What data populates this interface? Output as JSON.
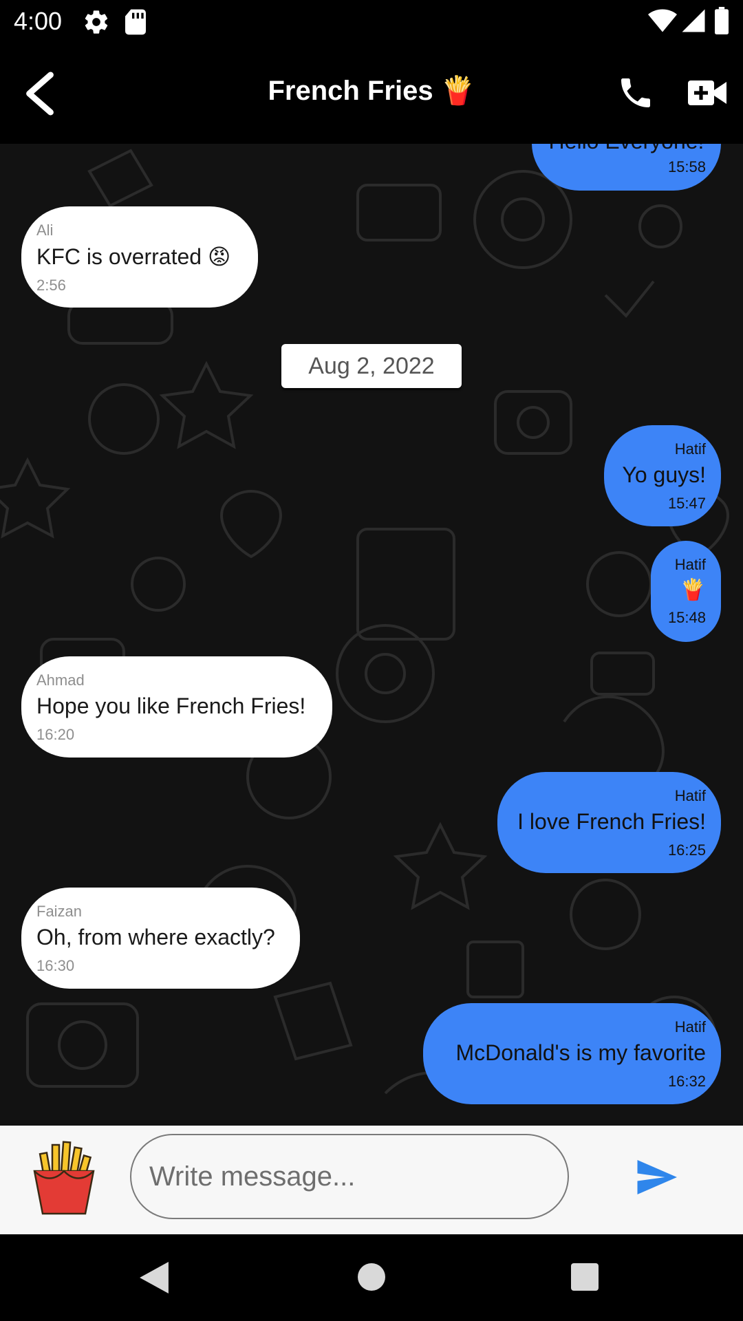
{
  "status_bar": {
    "time": "4:00",
    "icons": [
      "gear-icon",
      "sd-card-icon",
      "wifi-icon",
      "signal-icon",
      "battery-icon"
    ]
  },
  "header": {
    "title": "French Fries 🍟",
    "icons": [
      "back-arrow-icon",
      "phone-icon",
      "video-camera-icon"
    ]
  },
  "chat": {
    "partial_top_message": {
      "text": "Hello Everyone!",
      "time": "15:58"
    },
    "date_separator": "Aug 2, 2022",
    "messages": [
      {
        "sender": "Ali",
        "text": "KFC is overrated 😡",
        "time": "2:56",
        "direction": "incoming"
      },
      {
        "sender": "Hatif",
        "text": "Yo guys!",
        "time": "15:47",
        "direction": "outgoing"
      },
      {
        "sender": "Hatif",
        "text": "🍟",
        "time": "15:48",
        "direction": "outgoing"
      },
      {
        "sender": "Ahmad",
        "text": "Hope you like French Fries!",
        "time": "16:20",
        "direction": "incoming"
      },
      {
        "sender": "Hatif",
        "text": "I love French Fries!",
        "time": "16:25",
        "direction": "outgoing"
      },
      {
        "sender": "Faizan",
        "text": "Oh, from where exactly?",
        "time": "16:30",
        "direction": "incoming"
      },
      {
        "sender": "Hatif",
        "text": "McDonald's is my favorite",
        "time": "16:32",
        "direction": "outgoing"
      }
    ]
  },
  "composer": {
    "placeholder": "Write message...",
    "value": "",
    "icons": [
      "french-fries-icon",
      "send-icon"
    ]
  },
  "nav_bar": {
    "icons": [
      "nav-back-icon",
      "nav-home-icon",
      "nav-recents-icon"
    ]
  },
  "colors": {
    "outgoing_bubble": "#3d84f7",
    "incoming_bubble": "#ffffff",
    "chat_background": "#121212",
    "send_icon": "#2f86eb"
  }
}
